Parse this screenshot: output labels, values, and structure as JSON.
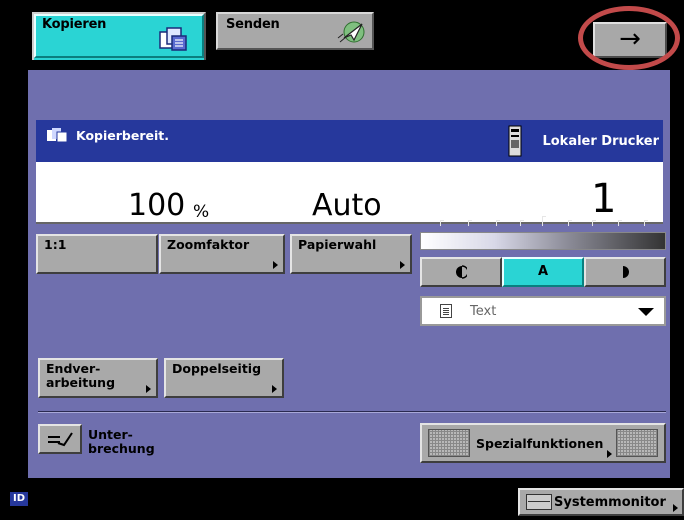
{
  "tabs": {
    "copy_label": "Kopieren",
    "send_label": "Senden",
    "next_arrow": "→"
  },
  "status": {
    "message": "Kopierbereit.",
    "printer": "Lokaler Drucker"
  },
  "display": {
    "zoom_value": "100",
    "zoom_unit": "%",
    "paper": "Auto",
    "copies": "1"
  },
  "buttons": {
    "ratio_1to1": "1:1",
    "zoom_factor": "Zoomfaktor",
    "paper_select": "Papierwahl",
    "finishing_line1": "Endver-",
    "finishing_line2": "arbeitung",
    "duplex": "Doppelseitig",
    "interrupt_line1": "Unter-",
    "interrupt_line2": "brechung",
    "special_functions": "Spezialfunktionen",
    "system_monitor": "Systemmonitor"
  },
  "density": {
    "auto_label": "A",
    "lighter_icon": "half-moon-light-icon",
    "darker_icon": "half-moon-dark-icon"
  },
  "original_type": {
    "selected": "Text"
  },
  "footer": {
    "id_badge": "ID"
  },
  "colors": {
    "panel": "#6f6fae",
    "status_bar": "#26389c",
    "active_tab": "#2ad4d4",
    "active_density": "#2ad4d4",
    "button": "#a9a9a9",
    "highlight_ring": "#c24a4a"
  }
}
